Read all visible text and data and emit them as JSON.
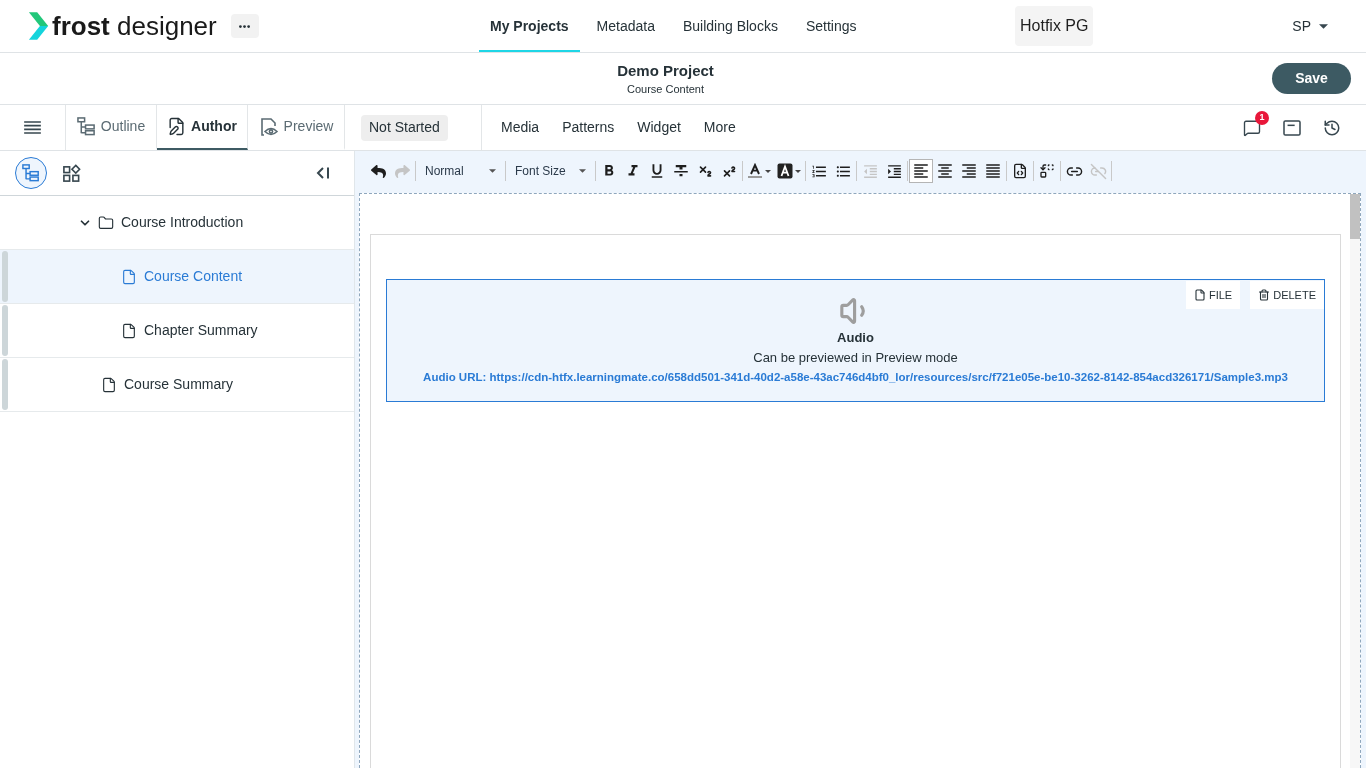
{
  "header": {
    "logo_text": "**frost** designer",
    "nav": [
      {
        "label": "My Projects",
        "selected": true
      },
      {
        "label": "Metadata",
        "selected": false
      },
      {
        "label": "Building Blocks",
        "selected": false
      },
      {
        "label": "Settings",
        "selected": false
      }
    ],
    "workspace": "Hotfix PG",
    "user": "SP"
  },
  "project_bar": {
    "title": "Demo Project",
    "subtitle": "Course Content",
    "save_button": "Save"
  },
  "mode_bar": {
    "tabs": [
      {
        "label": "Outline",
        "selected": false
      },
      {
        "label": "Author",
        "selected": true
      },
      {
        "label": "Preview",
        "selected": false
      }
    ],
    "status": "Not Started",
    "menus": [
      "Media",
      "Patterns",
      "Widget",
      "More"
    ],
    "comment_count": "1"
  },
  "sidebar": {
    "views": [
      {
        "selected": true
      },
      {
        "selected": false
      }
    ],
    "tree": [
      {
        "label": "Course Introduction",
        "kind": "folder",
        "expanded": true,
        "selected": false,
        "children": [
          {
            "label": "Course Content",
            "kind": "page",
            "selected": true
          },
          {
            "label": "Chapter Summary",
            "kind": "page",
            "selected": false
          }
        ]
      },
      {
        "label": "Course Summary",
        "kind": "page",
        "selected": false
      }
    ]
  },
  "editor": {
    "toolbar": {
      "history": [
        {
          "disabled": false
        },
        {
          "disabled": true
        }
      ],
      "paragraph_style": "Normal",
      "font_size": "Font Size",
      "indent": [
        {
          "disabled": true
        },
        {
          "disabled": false
        }
      ],
      "alignment": [
        {
          "selected": true
        },
        {
          "selected": false
        },
        {
          "selected": false
        },
        {
          "selected": false
        }
      ],
      "link": [
        {
          "disabled": false
        },
        {
          "disabled": true
        }
      ]
    },
    "audio_block": {
      "actions": [
        "FILE",
        "DELETE"
      ],
      "title": "Audio",
      "note": "Can be previewed in Preview mode",
      "url_text": "Audio URL: https://cdn-htfx.learningmate.co/658dd501-341d-40d2-a58e-43ac746d4bf0_lor/resources/src/f721e05e-be10-3262-8142-854acd326171/Sample3.mp3"
    }
  }
}
